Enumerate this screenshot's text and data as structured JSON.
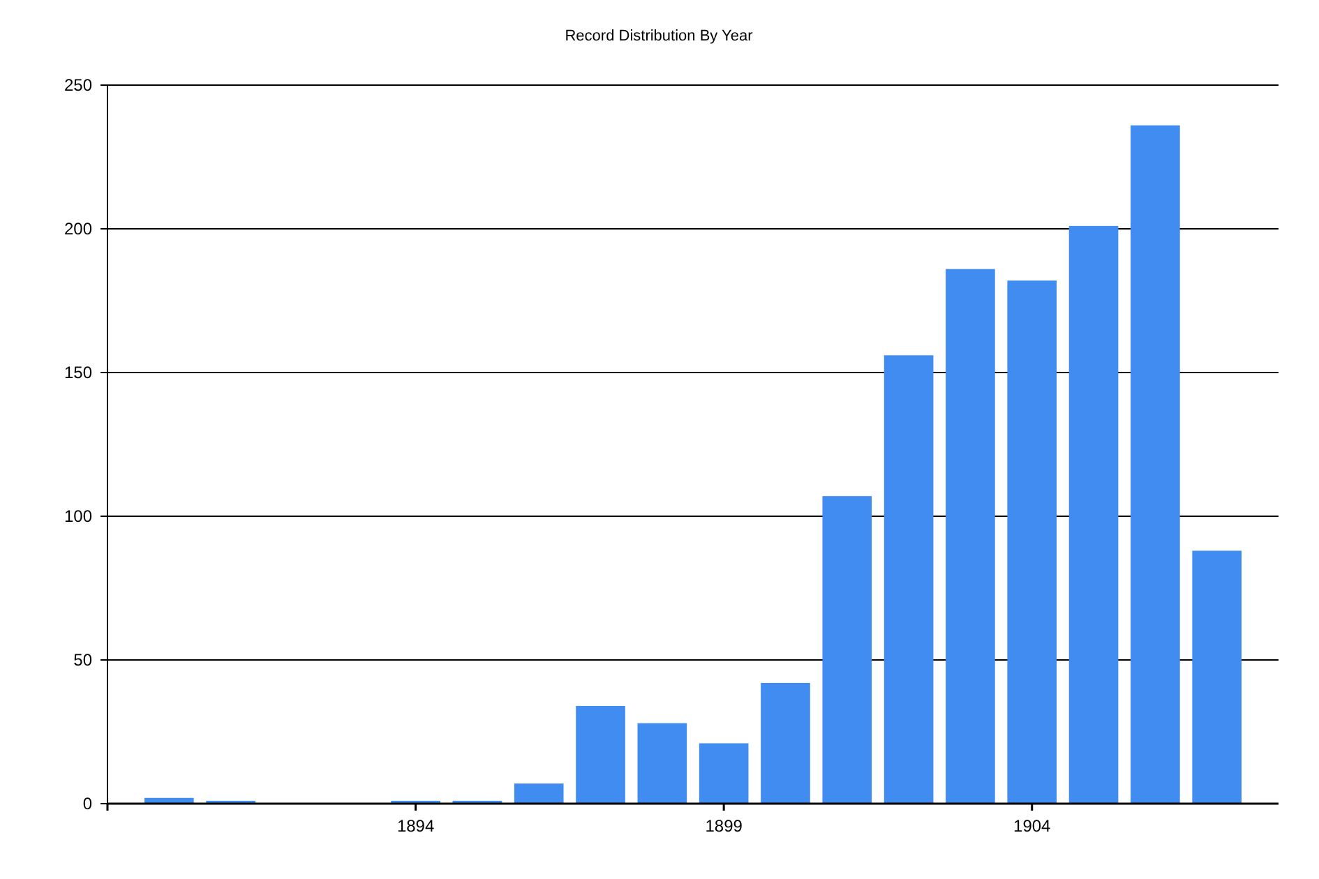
{
  "chart_data": {
    "type": "bar",
    "title": "Record Distribution By Year",
    "x": [
      1890,
      1891,
      1892,
      1893,
      1894,
      1895,
      1896,
      1897,
      1898,
      1899,
      1900,
      1901,
      1902,
      1903,
      1904,
      1905,
      1906,
      1907
    ],
    "series": [
      {
        "color": "#418cf0",
        "values": [
          2,
          1,
          null,
          null,
          1,
          1,
          7,
          34,
          28,
          21,
          42,
          107,
          156,
          186,
          182,
          201,
          236,
          88
        ]
      }
    ],
    "xlim": [
      1889,
      1908
    ],
    "ylim": [
      0,
      250
    ],
    "xticks": [
      1894,
      1899,
      1904
    ],
    "yticks": [
      0,
      50,
      100,
      150,
      200,
      250
    ],
    "grid": true
  }
}
